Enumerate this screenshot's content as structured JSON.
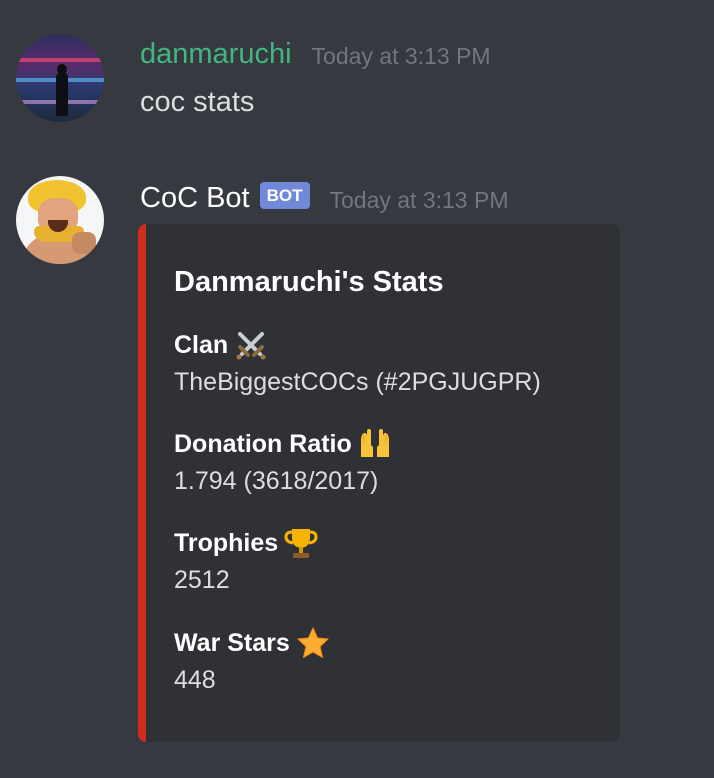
{
  "messages": [
    {
      "username": "danmaruchi",
      "timestamp": "Today at 3:13 PM",
      "text": "coc stats",
      "avatar_icon": "user-avatar",
      "username_color": "#43b581"
    },
    {
      "username": "CoC Bot",
      "bot_tag": "BOT",
      "timestamp": "Today at 3:13 PM",
      "avatar_icon": "barbarian-avatar",
      "username_color": "#ffffff",
      "embed": {
        "accent_color": "#cf2c1f",
        "title": "Danmaruchi's Stats",
        "fields": [
          {
            "name": "Clan",
            "icon": "crossed-swords-icon",
            "value": "TheBiggestCOCs (#2PGJUGPR)"
          },
          {
            "name": "Donation Ratio",
            "icon": "raised-hands-icon",
            "value": "1.794 (3618/2017)"
          },
          {
            "name": "Trophies",
            "icon": "trophy-icon",
            "value": "2512"
          },
          {
            "name": "War Stars",
            "icon": "star-icon",
            "value": "448"
          }
        ]
      }
    }
  ],
  "colors": {
    "background": "#36393f",
    "embed_background": "#2f3136",
    "timestamp": "#72767d",
    "bot_tag": "#7289da"
  }
}
